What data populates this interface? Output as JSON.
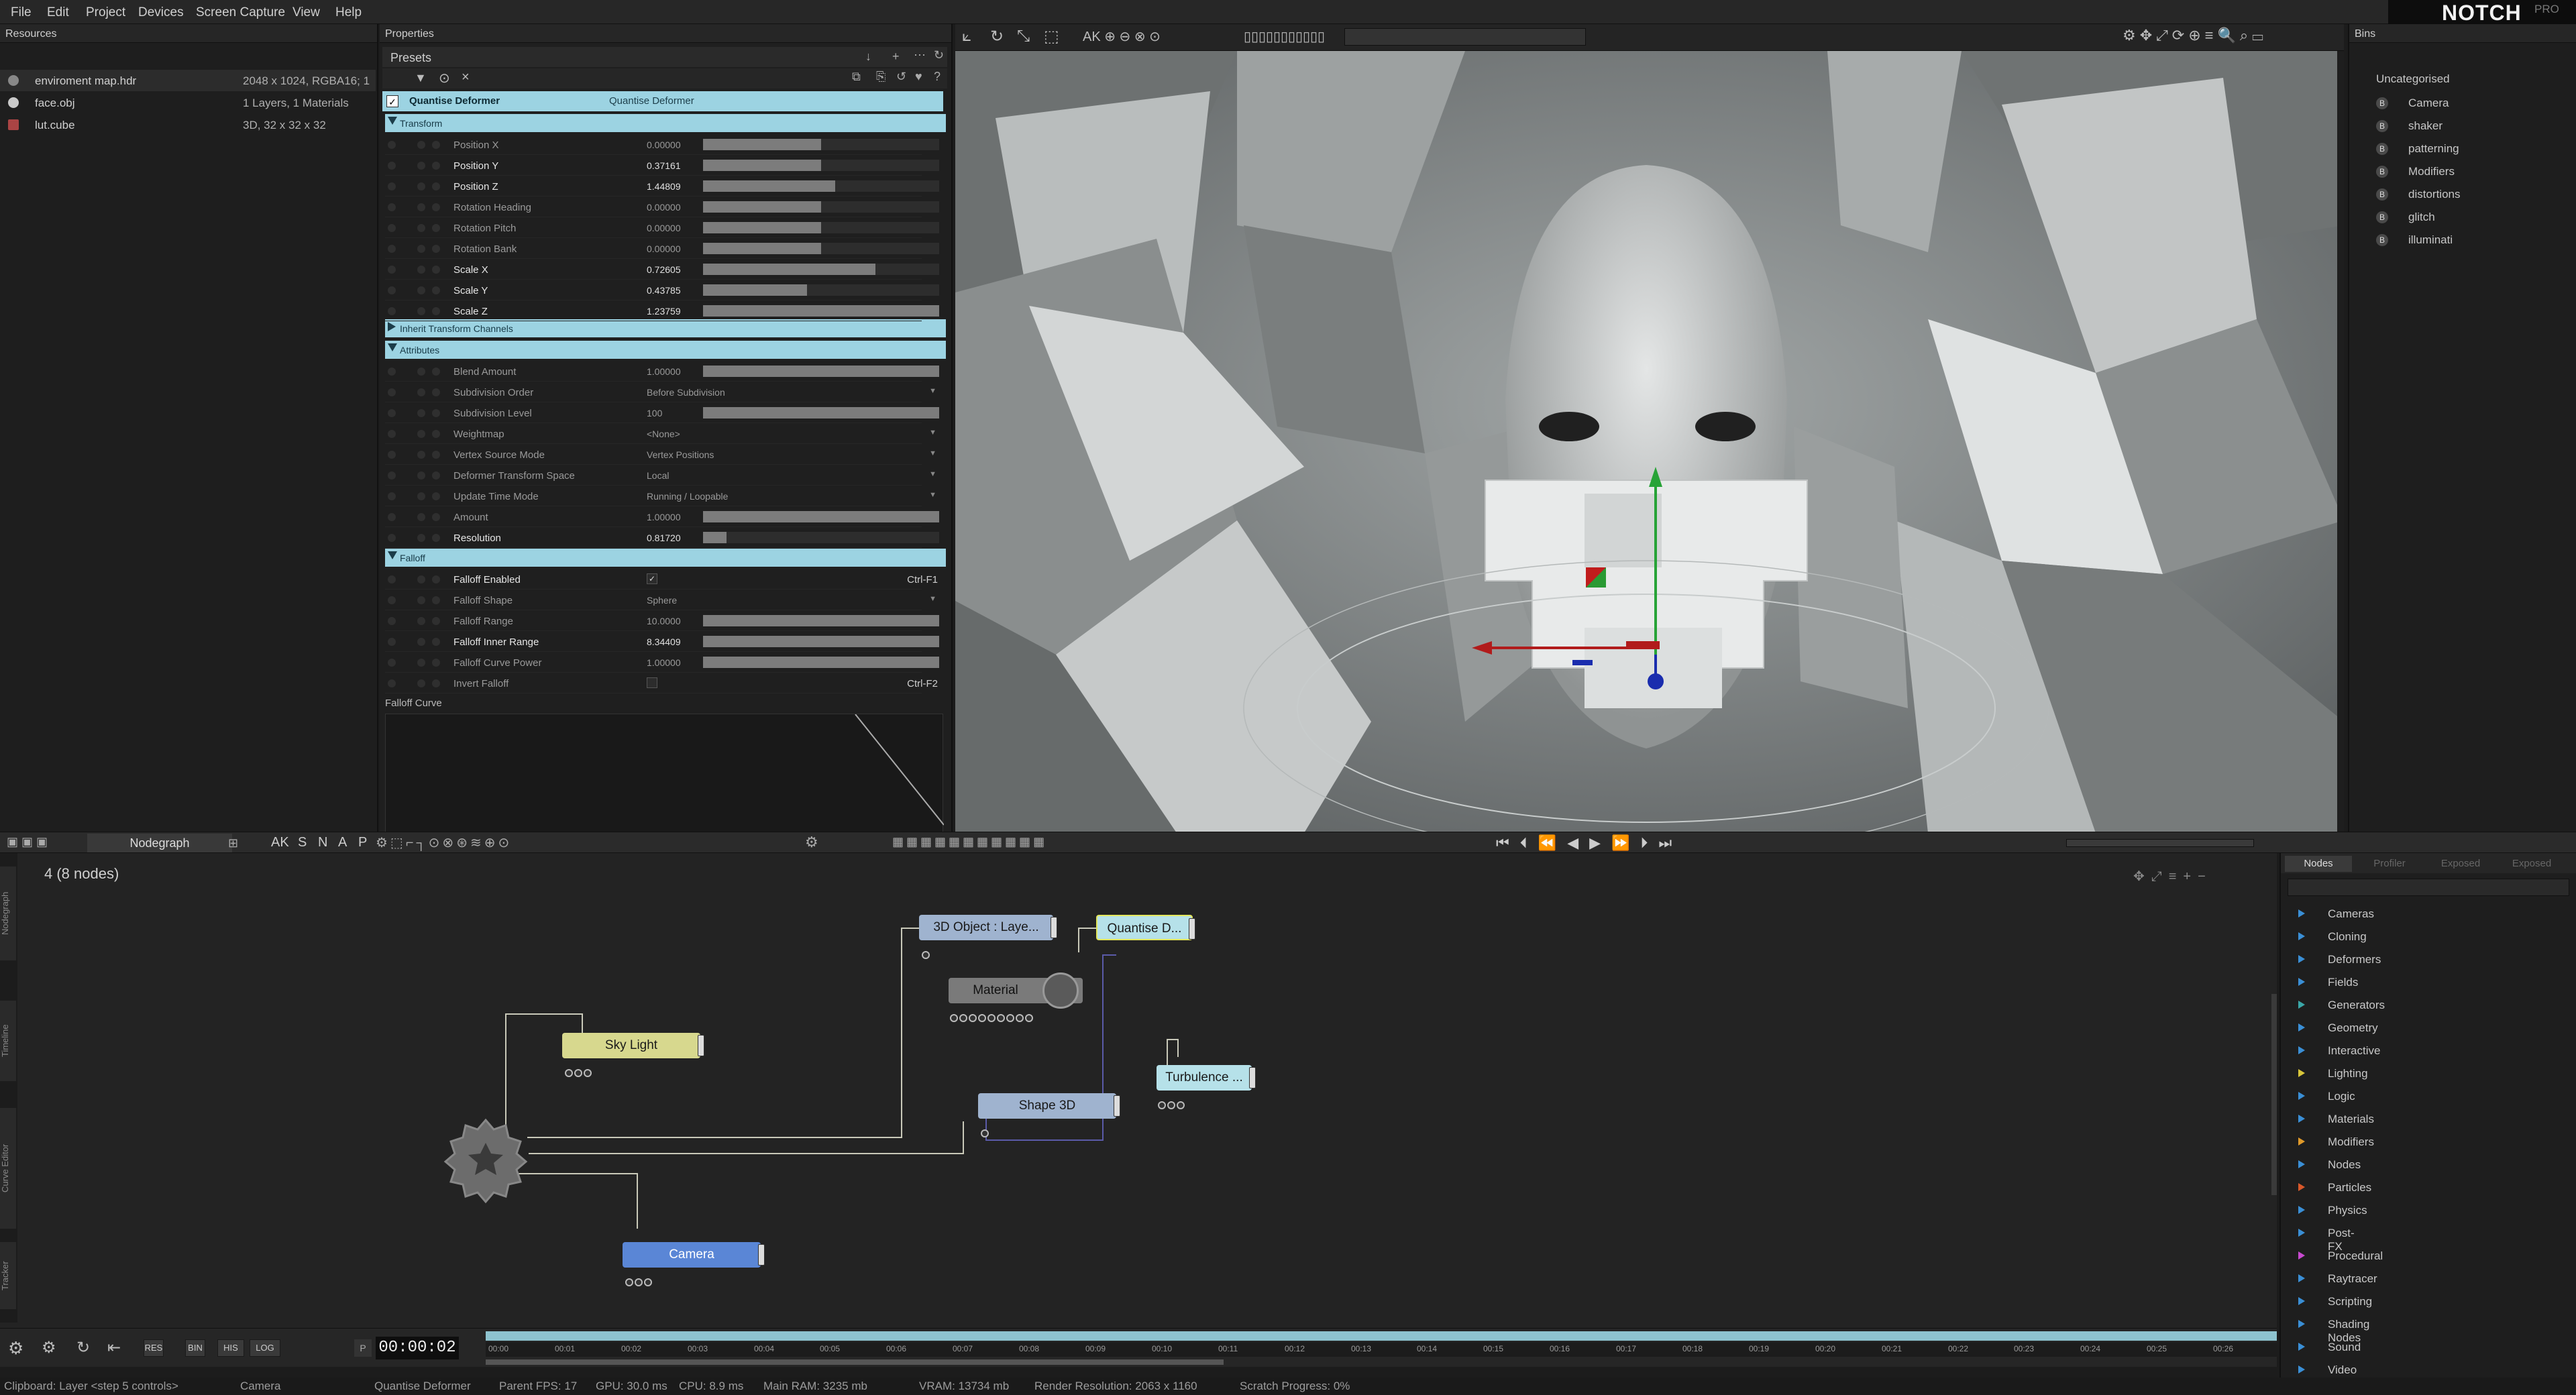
{
  "menu": [
    "File",
    "Edit",
    "Project",
    "Devices",
    "Screen Capture",
    "View",
    "Help"
  ],
  "logo": {
    "name": "NOTCH",
    "edition": "PRO"
  },
  "resources": {
    "title": "Resources",
    "items": [
      {
        "name": "enviroment map.hdr",
        "info": "2048 x 1024, RGBA16; 1"
      },
      {
        "name": "face.obj",
        "info": "1 Layers, 1 Materials"
      },
      {
        "name": "lut.cube",
        "info": "3D, 32 x 32 x 32"
      }
    ]
  },
  "properties": {
    "title": "Properties",
    "presets": "Presets",
    "node_name": "Quantise Deformer",
    "node_type": "Quantise Deformer",
    "sections": {
      "transform": "Transform",
      "inherit": "Inherit Transform Channels",
      "attributes": "Attributes",
      "falloff": "Falloff"
    },
    "transform": [
      {
        "label": "Position X",
        "value": "0.00000",
        "fill": 0.5,
        "hi": false
      },
      {
        "label": "Position Y",
        "value": "0.37161",
        "fill": 0.5,
        "hi": true
      },
      {
        "label": "Position Z",
        "value": "1.44809",
        "fill": 0.56,
        "hi": true
      },
      {
        "label": "Rotation Heading",
        "value": "0.00000",
        "fill": 0.5,
        "hi": false
      },
      {
        "label": "Rotation Pitch",
        "value": "0.00000",
        "fill": 0.5,
        "hi": false
      },
      {
        "label": "Rotation Bank",
        "value": "0.00000",
        "fill": 0.5,
        "hi": false
      },
      {
        "label": "Scale X",
        "value": "0.72605",
        "fill": 0.73,
        "hi": true
      },
      {
        "label": "Scale Y",
        "value": "0.43785",
        "fill": 0.44,
        "hi": true
      },
      {
        "label": "Scale Z",
        "value": "1.23759",
        "fill": 1.0,
        "hi": true
      }
    ],
    "attributes": [
      {
        "label": "Blend Amount",
        "value": "1.00000",
        "fill": 1.0,
        "kind": "bar",
        "hi": false
      },
      {
        "label": "Subdivision Order",
        "value": "Before Subdivision",
        "kind": "dd",
        "hi": false
      },
      {
        "label": "Subdivision Level",
        "value": "100",
        "fill": 1.0,
        "kind": "bar",
        "hi": false
      },
      {
        "label": "Weightmap",
        "value": "<None>",
        "kind": "dd",
        "hi": false
      },
      {
        "label": "Vertex Source Mode",
        "value": "Vertex Positions",
        "kind": "dd",
        "hi": false
      },
      {
        "label": "Deformer Transform Space",
        "value": "Local",
        "kind": "dd",
        "hi": false
      },
      {
        "label": "Update Time Mode",
        "value": "Running / Loopable",
        "kind": "dd",
        "hi": false
      },
      {
        "label": "Amount",
        "value": "1.00000",
        "fill": 1.0,
        "kind": "bar",
        "hi": false
      },
      {
        "label": "Resolution",
        "value": "0.81720",
        "fill": 0.1,
        "kind": "bar",
        "hi": true
      }
    ],
    "falloff": [
      {
        "label": "Falloff Enabled",
        "value": "✓",
        "kind": "check",
        "shortcut": "Ctrl-F1",
        "hi": true
      },
      {
        "label": "Falloff Shape",
        "value": "Sphere",
        "kind": "dd",
        "hi": false
      },
      {
        "label": "Falloff Range",
        "value": "10.0000",
        "fill": 1.0,
        "kind": "bar",
        "hi": false
      },
      {
        "label": "Falloff Inner Range",
        "value": "8.34409",
        "fill": 1.0,
        "kind": "bar",
        "hi": true
      },
      {
        "label": "Falloff Curve Power",
        "value": "1.00000",
        "fill": 1.0,
        "kind": "bar",
        "hi": false
      },
      {
        "label": "Invert Falloff",
        "value": "",
        "kind": "check",
        "shortcut": "Ctrl-F2",
        "hi": false
      }
    ],
    "falloff_curve": "Falloff Curve"
  },
  "bins": {
    "title": "Bins",
    "group": "Uncategorised",
    "items": [
      "Camera",
      "shaker",
      "patterning",
      "Modifiers",
      "distortions",
      "glitch",
      "illuminati"
    ],
    "icon_letter": "B"
  },
  "nodegraph": {
    "tab": "Nodegraph",
    "snap": [
      "AK",
      "S",
      "N",
      "A",
      "P"
    ],
    "count": "4  (8 nodes)",
    "nodes": {
      "obj": "3D Object : Laye...",
      "quant": "Quantise D...",
      "mat": "Material",
      "sky": "Sky Light",
      "turb": "Turbulence ...",
      "shape": "Shape 3D",
      "cam": "Camera"
    },
    "side_tabs": [
      "Nodegraph",
      "Timeline",
      "Curve Editor",
      "Tracker"
    ]
  },
  "nodes_panel": {
    "tabs": [
      "Nodes",
      "Profiler",
      "Exposed",
      "Exposed"
    ],
    "categories": [
      {
        "name": "Cameras",
        "color": "#3a8fd6"
      },
      {
        "name": "Cloning",
        "color": "#3a8fd6"
      },
      {
        "name": "Deformers",
        "color": "#3a8fd6"
      },
      {
        "name": "Fields",
        "color": "#3a8fd6"
      },
      {
        "name": "Generators",
        "color": "#3aa7a8"
      },
      {
        "name": "Geometry",
        "color": "#3a8fd6"
      },
      {
        "name": "Interactive",
        "color": "#3a8fd6"
      },
      {
        "name": "Lighting",
        "color": "#d8c63a"
      },
      {
        "name": "Logic",
        "color": "#3a8fd6"
      },
      {
        "name": "Materials",
        "color": "#3a8fd6"
      },
      {
        "name": "Modifiers",
        "color": "#e09a2a"
      },
      {
        "name": "Nodes",
        "color": "#3a8fd6"
      },
      {
        "name": "Particles",
        "color": "#d8582a"
      },
      {
        "name": "Physics",
        "color": "#3a8fd6"
      },
      {
        "name": "Post-FX",
        "color": "#3a8fd6"
      },
      {
        "name": "Procedural",
        "color": "#c84ad0"
      },
      {
        "name": "Raytracer",
        "color": "#3a8fd6"
      },
      {
        "name": "Scripting",
        "color": "#3a8fd6"
      },
      {
        "name": "Shading Nodes",
        "color": "#3a8fd6"
      },
      {
        "name": "Sound",
        "color": "#3a8fd6"
      },
      {
        "name": "Video Processing",
        "color": "#3a8fd6"
      }
    ]
  },
  "timeline": {
    "time": "00:00:02",
    "buttons": [
      "RES",
      "BIN",
      "HIS",
      "LOG"
    ],
    "play_marker": "P",
    "ticks": [
      "00:00",
      "00:01",
      "00:02",
      "00:03",
      "00:04",
      "00:05",
      "00:06",
      "00:07",
      "00:08",
      "00:09",
      "00:10",
      "00:11",
      "00:12",
      "00:13",
      "00:14",
      "00:15",
      "00:16",
      "00:17",
      "00:18",
      "00:19",
      "00:20",
      "00:21",
      "00:22",
      "00:23",
      "00:24",
      "00:25",
      "00:26"
    ]
  },
  "status": {
    "clipboard": "Clipboard: Layer <step 5 controls>",
    "camera": "Camera",
    "selected": "Quantise Deformer",
    "parent_fps": "Parent FPS: 17",
    "gpu": "GPU: 30.0 ms",
    "cpu": "CPU: 8.9 ms",
    "ram": "Main RAM: 3235 mb",
    "vram": "VRAM: 13734 mb",
    "render_res": "Render Resolution: 2063 x 1160",
    "scratch": "Scratch Progress: 0%"
  },
  "colors": {
    "accent": "#9cd3e2",
    "node_object": "#9fb3cf",
    "node_deformer": "#9cd3e2",
    "node_light": "#d7d88e",
    "node_camera": "#5a86d6",
    "node_material": "#7a7a7a"
  }
}
